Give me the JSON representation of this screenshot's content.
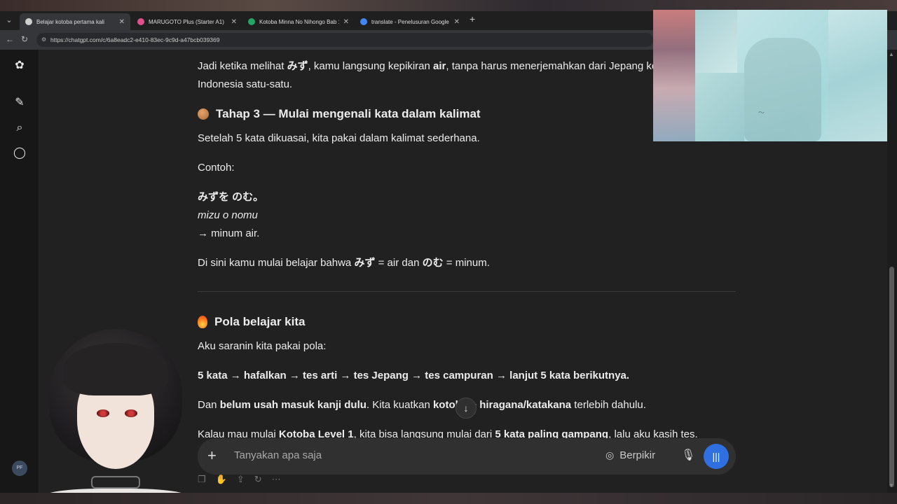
{
  "browser": {
    "tabs": [
      {
        "title": "Belajar kotoba pertama kali",
        "fav_color": "#cfcfcf",
        "active": true
      },
      {
        "title": "MARUGOTO Plus (Starter A1)",
        "fav_color": "#e0508a",
        "active": false
      },
      {
        "title": "Kotoba Minna No Nihongo Bab 1",
        "fav_color": "#22a565",
        "active": false
      },
      {
        "title": "translate - Penelusuran Google",
        "fav_color": "#4285f4",
        "active": false
      }
    ],
    "tab_close": "✕",
    "new_tab": "+",
    "url": "https://chatgpt.com/c/6a8eadc2-e410-83ec-9c9d-a47bcb039369"
  },
  "sidebar": {
    "avatar_initials": "PF"
  },
  "message": {
    "intro_line1_a": "Jadi ketika melihat ",
    "intro_line1_b": "みず",
    "intro_line1_c": ", kamu langsung kepikiran ",
    "intro_line1_d": "air",
    "intro_line1_e": ", tanpa harus menerjemahkan dari Jepang ke",
    "intro_line2": "Indonesia satu-satu.",
    "step3_heading": "Tahap 3 — Mulai mengenali kata dalam kalimat",
    "step3_p1": "Setelah 5 kata dikuasai, kita pakai dalam kalimat sederhana.",
    "step3_example_label": "Contoh:",
    "step3_jp": "みずを のむ。",
    "step3_romaji": "mizu o nomu",
    "step3_translation": "→ minum air.",
    "step3_p3_a": "Di sini kamu mulai belajar bahwa ",
    "step3_p3_b": "みず",
    "step3_p3_c": " = air dan ",
    "step3_p3_d": "のむ",
    "step3_p3_e": " = minum.",
    "pattern_heading": "Pola belajar kita",
    "pattern_p1": "Aku saranin kita pakai pola:",
    "pattern_flow": "5 kata → hafalkan → tes arti → tes Jepang → tes campuran → lanjut 5 kata berikutnya.",
    "pattern_p3_a": "Dan ",
    "pattern_p3_b": "belum usah masuk kanji dulu",
    "pattern_p3_c": ". Kita kuatkan ",
    "pattern_p3_d": "kotoba + hiragana/katakana",
    "pattern_p3_e": " terlebih dahulu.",
    "pattern_p4_a": "Kalau mau mulai ",
    "pattern_p4_b": "Kotoba Level 1",
    "pattern_p4_c": ", kita bisa langsung mulai dari ",
    "pattern_p4_d": "5 kata paling gampang",
    "pattern_p4_e": ", lalu aku kasih tes."
  },
  "composer": {
    "placeholder": "Tanyakan apa saja",
    "think_label": "Berpikir"
  },
  "icons": {
    "logo": "openai-logo-icon",
    "new_chat": "new-chat-icon",
    "search": "search-icon",
    "chat": "chat-bubble-icon"
  }
}
